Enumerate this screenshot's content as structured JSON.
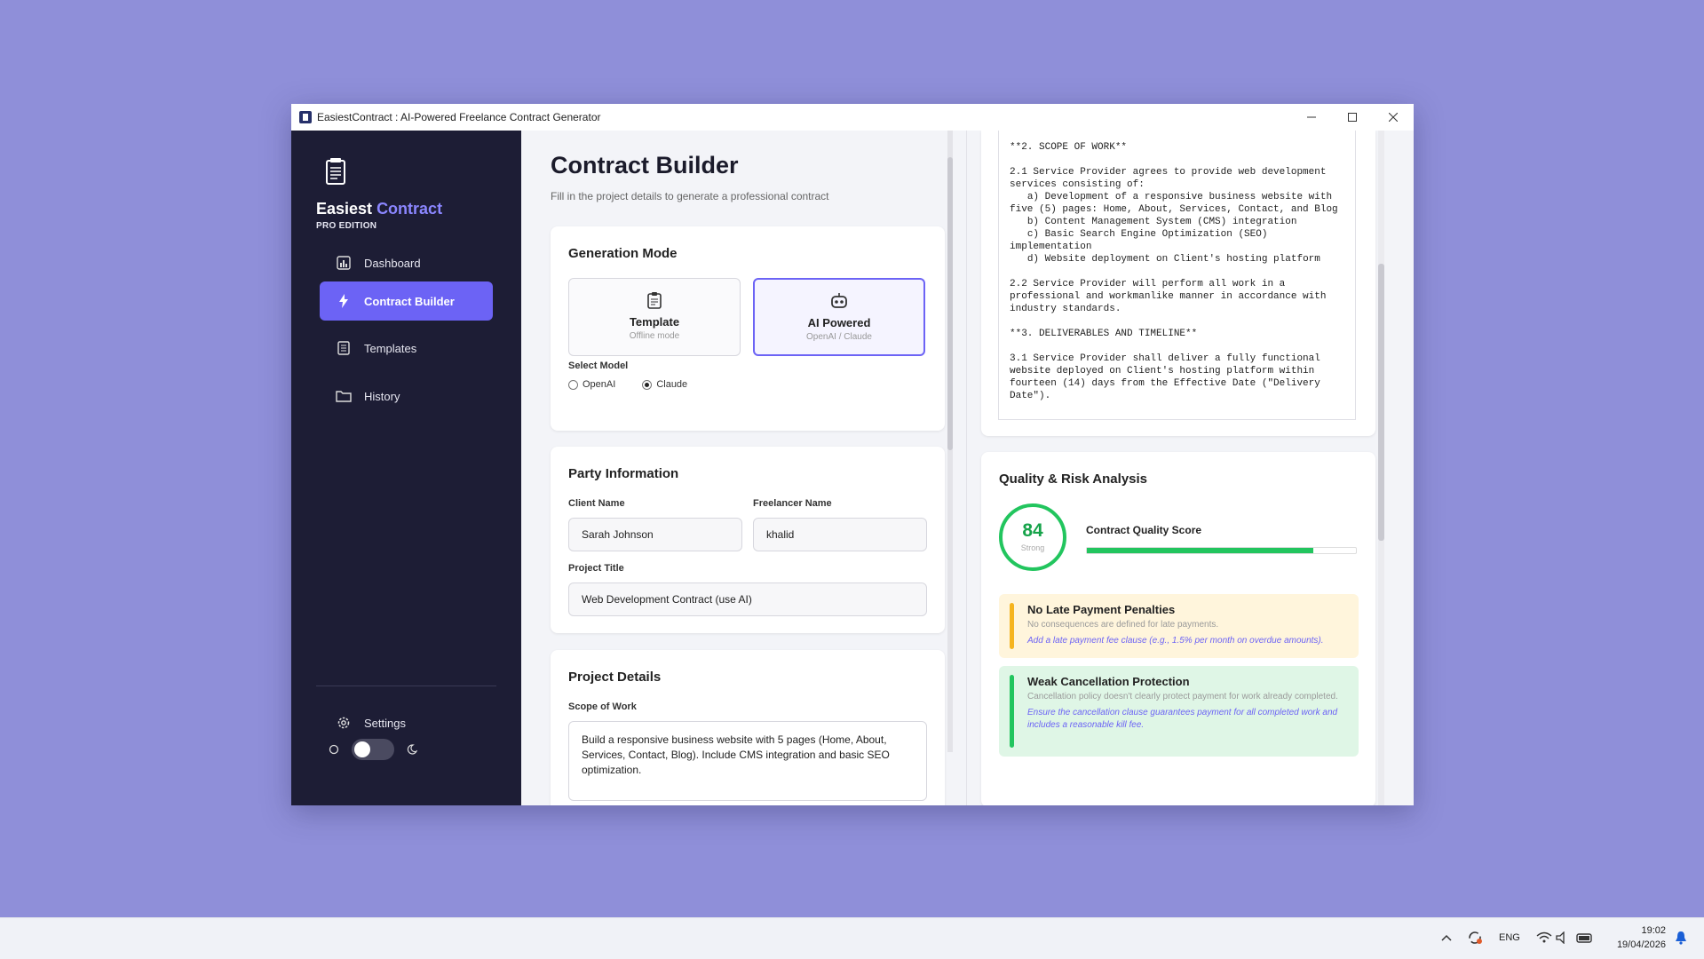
{
  "window": {
    "title": "EasiestContract : AI-Powered Freelance Contract Generator"
  },
  "sidebar": {
    "brand_main": "Easiest",
    "brand_accent": "Contract",
    "edition": "PRO EDITION",
    "items": [
      {
        "label": "Dashboard",
        "icon": "bar-chart-icon"
      },
      {
        "label": "Contract Builder",
        "icon": "lightning-icon"
      },
      {
        "label": "Templates",
        "icon": "document-icon"
      },
      {
        "label": "History",
        "icon": "folder-icon"
      }
    ],
    "settings_label": "Settings"
  },
  "builder": {
    "title": "Contract Builder",
    "subtitle": "Fill in the project details to generate a professional contract",
    "generation": {
      "title": "Generation Mode",
      "template_label": "Template",
      "template_sub": "Offline mode",
      "ai_label": "AI Powered",
      "ai_sub": "OpenAI / Claude",
      "model_label": "Select Model",
      "model_openai": "OpenAI",
      "model_claude": "Claude",
      "selected_model": "Claude"
    },
    "party": {
      "title": "Party Information",
      "client_label": "Client Name",
      "client_value": "Sarah Johnson",
      "freelancer_label": "Freelancer Name",
      "freelancer_value": "khalid",
      "project_label": "Project Title",
      "project_value": "Web Development Contract (use AI)"
    },
    "details": {
      "title": "Project Details",
      "scope_label": "Scope of Work",
      "scope_value": "Build a responsive business website with 5 pages (Home, About, Services, Contact, Blog). Include CMS integration and basic SEO optimization."
    }
  },
  "preview": {
    "text": "**2. SCOPE OF WORK**\n\n2.1 Service Provider agrees to provide web development services consisting of:\n   a) Development of a responsive business website with five (5) pages: Home, About, Services, Contact, and Blog\n   b) Content Management System (CMS) integration\n   c) Basic Search Engine Optimization (SEO) implementation\n   d) Website deployment on Client's hosting platform\n\n2.2 Service Provider will perform all work in a professional and workmanlike manner in accordance with industry standards.\n\n**3. DELIVERABLES AND TIMELINE**\n\n3.1 Service Provider shall deliver a fully functional website deployed on Client's hosting platform within fourteen (14) days from the Effective Date (\"Delivery Date\")."
  },
  "analysis": {
    "title": "Quality & Risk Analysis",
    "score": "84",
    "score_label": "Strong",
    "score_title": "Contract Quality Score",
    "score_fraction": 0.84,
    "issues": [
      {
        "title": "No Late Payment Penalties",
        "desc": "No consequences are defined for late payments.",
        "fix": "Add a late payment fee clause (e.g., 1.5% per month on overdue amounts).",
        "bg": "#fff5dc",
        "stripe": "#f5b41f"
      },
      {
        "title": "Weak Cancellation Protection",
        "desc": "Cancellation policy doesn't clearly protect payment for work already completed.",
        "fix": "Ensure the cancellation clause guarantees payment for all completed work and includes a reasonable kill fee.",
        "bg": "#dff6e6",
        "stripe": "#22c55e"
      }
    ]
  },
  "taskbar": {
    "lang": "ENG",
    "time": "19:02",
    "date": "19/04/2026"
  },
  "colors": {
    "accent": "#6c63f5",
    "sidebar_bg": "#1d1d35",
    "score_green": "#22c55e",
    "desktop": "#8f8fd9"
  }
}
